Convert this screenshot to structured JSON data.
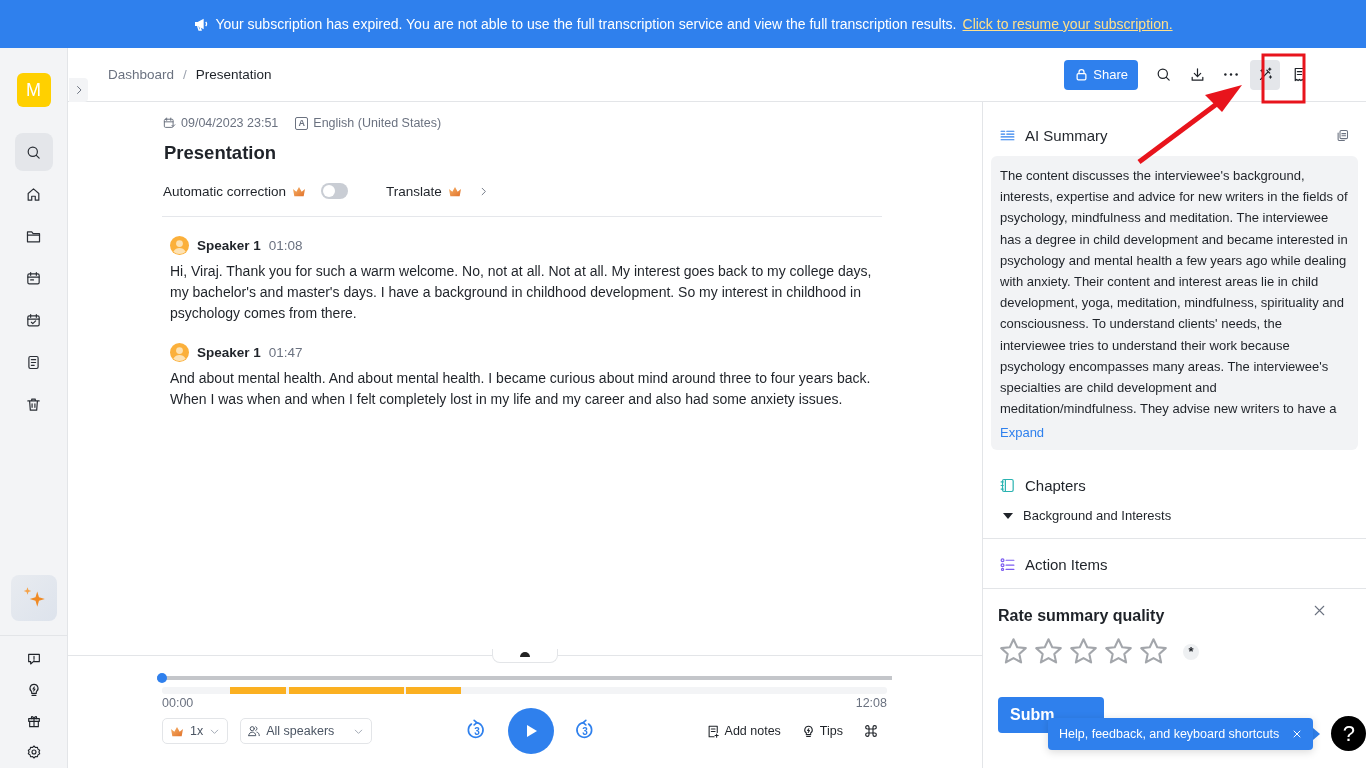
{
  "banner": {
    "message": "Your subscription has expired. You are not able to use the full transcription service and view the full transcription results.",
    "link": "Click to resume your subscription."
  },
  "sidebar": {
    "avatar": "M",
    "items": [
      {
        "selected": true
      },
      {
        "selected": false
      },
      {
        "selected": false
      },
      {
        "selected": false
      },
      {
        "selected": false
      },
      {
        "selected": false
      },
      {
        "selected": false
      }
    ]
  },
  "breadcrumb": [
    "Dashboard",
    "Presentation"
  ],
  "breadcrumb_separator": "/",
  "toolbar": {
    "share": "Share",
    "tools": [
      {
        "selected": false
      },
      {
        "selected": false
      },
      {
        "selected": false
      },
      {
        "selected": true
      },
      {
        "selected": false
      }
    ]
  },
  "recording": {
    "date": "09/04/2023 23:51",
    "language_badge": "A",
    "language": "English (United States)",
    "title": "Presentation",
    "options": [
      {
        "kind": "toggle",
        "label": "Automatic correction",
        "premium": true,
        "on": false
      },
      {
        "kind": "link",
        "label": "Translate",
        "premium": true
      }
    ]
  },
  "segments": [
    {
      "speaker": "Speaker 1",
      "time": "01:08",
      "text": "Hi, Viraj. Thank you for such a warm welcome. No, not at all. Not at all. My interest goes back to my college days, my bachelor's and master's days. I have a background in childhood development. So my interest in childhood in psychology comes from there."
    },
    {
      "speaker": "Speaker 1",
      "time": "01:47",
      "text": "And about mental health. And about mental health. I became curious about mind around three to four years back. When I was when and when I felt completely lost in my life and my career and also had some anxiety issues."
    }
  ],
  "player": {
    "level": 0,
    "start": "00:00",
    "end": "12:08",
    "speed": "1x",
    "speakers": "All speakers",
    "rewind": "3",
    "forward": "3",
    "tools": [
      "Add notes",
      "Tips"
    ]
  },
  "summary": {
    "title": "AI Summary",
    "text": "The content discusses the interviewee's background, interests, expertise and advice for new writers in the fields of psychology, mindfulness and meditation. The interviewee has a degree in child development and became interested in psychology and mental health a few years ago while dealing with anxiety. Their content and interest areas lie in child development, yoga, meditation, mindfulness, spirituality and consciousness. To understand clients' needs, the interviewee tries to understand their work because psychology encompasses many areas. The interviewee's specialties are child development and meditation/mindfulness. They advise new writers to have a",
    "expand": "Expand"
  },
  "chapters": {
    "title": "Chapters",
    "items": [
      {
        "label": "Background and Interests",
        "expanded": true
      }
    ]
  },
  "action_items": {
    "title": "Action Items"
  },
  "rating": {
    "title": "Rate summary quality",
    "stars": 0,
    "required": "*",
    "submit": "Subm"
  },
  "help": {
    "tooltip": "Help, feedback, and keyboard shortcuts",
    "button": "?"
  }
}
